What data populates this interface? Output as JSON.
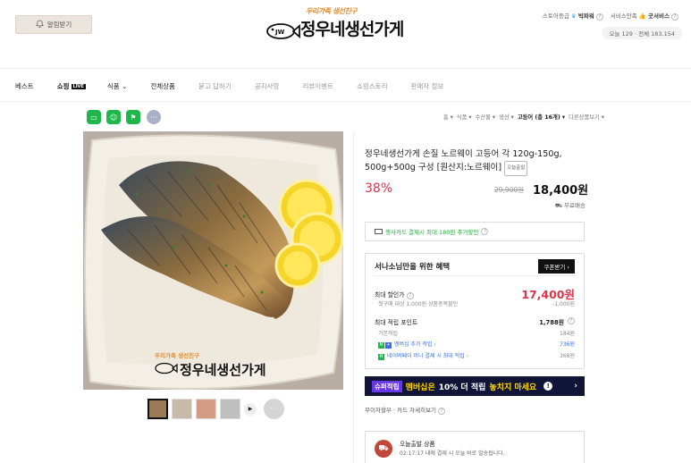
{
  "header": {
    "notify_label": "알림받기",
    "logo_slogan": "우리가족 생선친구",
    "logo_name": "정우네생선가게",
    "store_grade_label": "스토어등급",
    "store_grade_value": "빅파워",
    "service_label": "서비스만족",
    "service_value": "굿서비스",
    "visits": "오늘 129 · 전체 183,154"
  },
  "nav": {
    "items": [
      "베스트",
      "쇼핑",
      "식품",
      "전체상품",
      "묻고 답하기",
      "공지사항",
      "리뷰이벤트",
      "쇼핑스토리",
      "판매자 정보"
    ],
    "live_badge": "LIVE",
    "food_chevron": "⌄"
  },
  "breadcrumbs": [
    "홈 ▾",
    "식품 ▾",
    "수산물 ▾",
    "생선 ▾",
    "고등어 (총 16개) ▾",
    "다른상품보기 ▾"
  ],
  "product": {
    "title": "정우네생선가게 손질 노르웨이 고등어 각 120g-150g, 500g+500g 구성 [원산지:노르웨이]",
    "today_ship_badge": "오늘출발",
    "discount": "38%",
    "original_price": "29,900원",
    "sale_price": "18,400원",
    "shipping": "무료배송",
    "image_watermark_slogan": "우리가족 생선친구",
    "image_watermark_name": "정우네생선가게"
  },
  "card_promo": "행사카드 결제시 최대 180원 추가할인",
  "benefit": {
    "title": "서나소님만을 위한 혜택",
    "coupon_label": "쿠폰받기",
    "max_discount_label": "최대 할인가",
    "max_discount_value": "17,400원",
    "coupon_note": "첫구매 대상 1,000원 상품중복할인",
    "coupon_note_value": "-1,000원",
    "points_label": "최대 적립 포인트",
    "points_value": "1,788원",
    "basic_label": "기본적립",
    "basic_value": "184원",
    "membership_label": "멤버십 추가 적립",
    "membership_value": "736원",
    "naver_label": "네이버페이 머니 결제 시 최대 적립",
    "naver_value": "368원"
  },
  "banner": {
    "chip": "슈퍼적립",
    "text_a": "멤버십은",
    "text_b": "10% 더 적립",
    "text_c": "놓치지 마세요"
  },
  "installment": "무이자할부 · 카드 자세히보기",
  "today_ship": {
    "title": "오늘출발 상품",
    "deadline": "02:17:17 내에 결제 시 오늘 바로 발송됩니다."
  },
  "colors": {
    "accent_red": "#e0344a",
    "naver_green": "#1fb64b",
    "banner_navy": "#101538",
    "banner_purple": "#6a36ea"
  }
}
